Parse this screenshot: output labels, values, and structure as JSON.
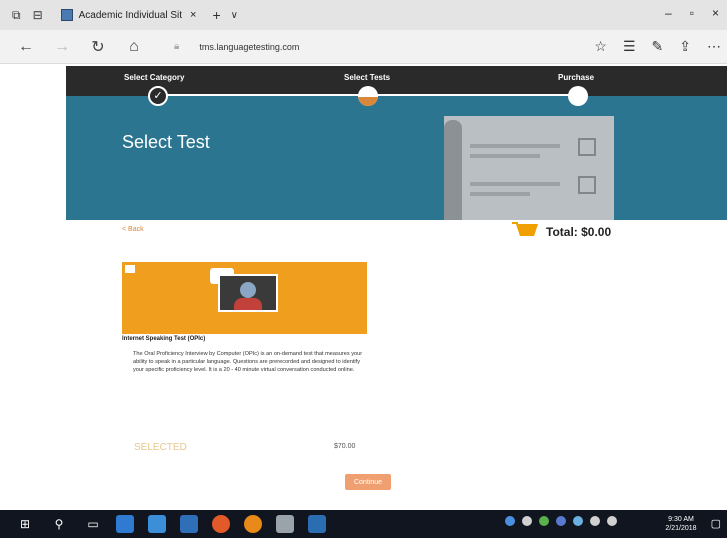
{
  "browser": {
    "tab_title": "Academic Individual Sit",
    "tab_close": "×",
    "new_tab": "+",
    "tab_menu": "∨",
    "url": "tms.languagetesting.com"
  },
  "window_controls": {
    "minimize": "–",
    "maximize": "▫",
    "close": "×"
  },
  "progress": {
    "steps": [
      "Select Category",
      "Select Tests",
      "Purchase"
    ],
    "completed_index": 0,
    "current_index": 1
  },
  "hero": {
    "title": "Select Test"
  },
  "cart": {
    "back_label": "< Back",
    "total_label": "Total: $0.00"
  },
  "test_card": {
    "title": "Internet Speaking Test (OPIc)",
    "description": "The Oral Proficiency Interview by Computer (OPIc) is an on-demand test that measures your ability to speak in a particular language. Questions are prerecorded and designed to identify your specific proficiency level. It is a 20 - 40 minute virtual conversation conducted online.",
    "select_label": "SELECTED",
    "price": "$70.00"
  },
  "actions": {
    "continue_label": "Continue"
  },
  "taskbar": {
    "time": "9:30 AM",
    "date": "2/21/2018"
  },
  "colors": {
    "hero_bg": "#2b7591",
    "topbar_bg": "#2a2a2a",
    "accent_orange": "#f09e1d",
    "continue_bg": "#f0a070"
  }
}
